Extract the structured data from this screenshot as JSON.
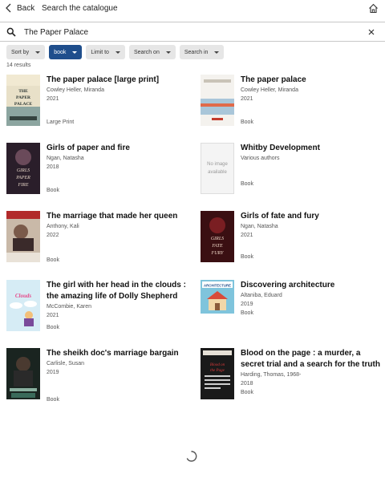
{
  "header": {
    "back_label": "Back",
    "title": "Search the catalogue"
  },
  "search": {
    "value": "The Paper Palace"
  },
  "filters": [
    {
      "label": "Sort by",
      "active": false
    },
    {
      "label": "book",
      "active": true
    },
    {
      "label": "Limit to",
      "active": false
    },
    {
      "label": "Search on",
      "active": false
    },
    {
      "label": "Search in",
      "active": false
    }
  ],
  "results_count": "14 results",
  "results": [
    {
      "title": "The paper palace [large print]",
      "author": "Cowley Heller, Miranda",
      "year": "2021",
      "format": "Large Print"
    },
    {
      "title": "The paper palace",
      "author": "Cowley Heller, Miranda",
      "year": "2021",
      "format": "Book"
    },
    {
      "title": "Girls of paper and fire",
      "author": "Ngan, Natasha",
      "year": "2018",
      "format": "Book"
    },
    {
      "title": "Whitby Development",
      "author": "Various authors",
      "year": "",
      "format": "Book",
      "no_image": "No image available"
    },
    {
      "title": "The marriage that made her queen",
      "author": "Anthony, Kali",
      "year": "2022",
      "format": "Book"
    },
    {
      "title": "Girls of fate and fury",
      "author": "Ngan, Natasha",
      "year": "2021",
      "format": "Book"
    },
    {
      "title": "The girl with her head in the clouds : the amazing life of Dolly Shepherd",
      "author": "McCombie, Karen",
      "year": "2021",
      "format": "Book"
    },
    {
      "title": "Discovering architecture",
      "author": "Altaniba, Eduard",
      "year": "2019",
      "format": "Book"
    },
    {
      "title": "The sheikh doc's marriage bargain",
      "author": "Carlisle, Susan",
      "year": "2019",
      "format": "Book"
    },
    {
      "title": "Blood on the page : a murder, a secret trial and a search for the truth",
      "author": "Harding, Thomas, 1968-",
      "year": "2018",
      "format": "Book"
    }
  ],
  "cover_text": {
    "c0": "THE PAPER PALACE",
    "c2a": "GIRLS",
    "c2b": "PAPER",
    "c2c": "FIRE",
    "c5a": "GIRLS",
    "c5b": "FATE",
    "c5c": "FURY",
    "c6": "Clouds",
    "c7": "ARCHITECTURE",
    "c9": "Blood on the Page"
  },
  "icons": {
    "back": "chevron-left-icon",
    "home": "home-icon",
    "search": "search-icon",
    "clear": "close-icon",
    "loading": "spinner-icon"
  },
  "colors": {
    "accent": "#1f4e8c",
    "chip_bg": "#e6e6e6"
  }
}
